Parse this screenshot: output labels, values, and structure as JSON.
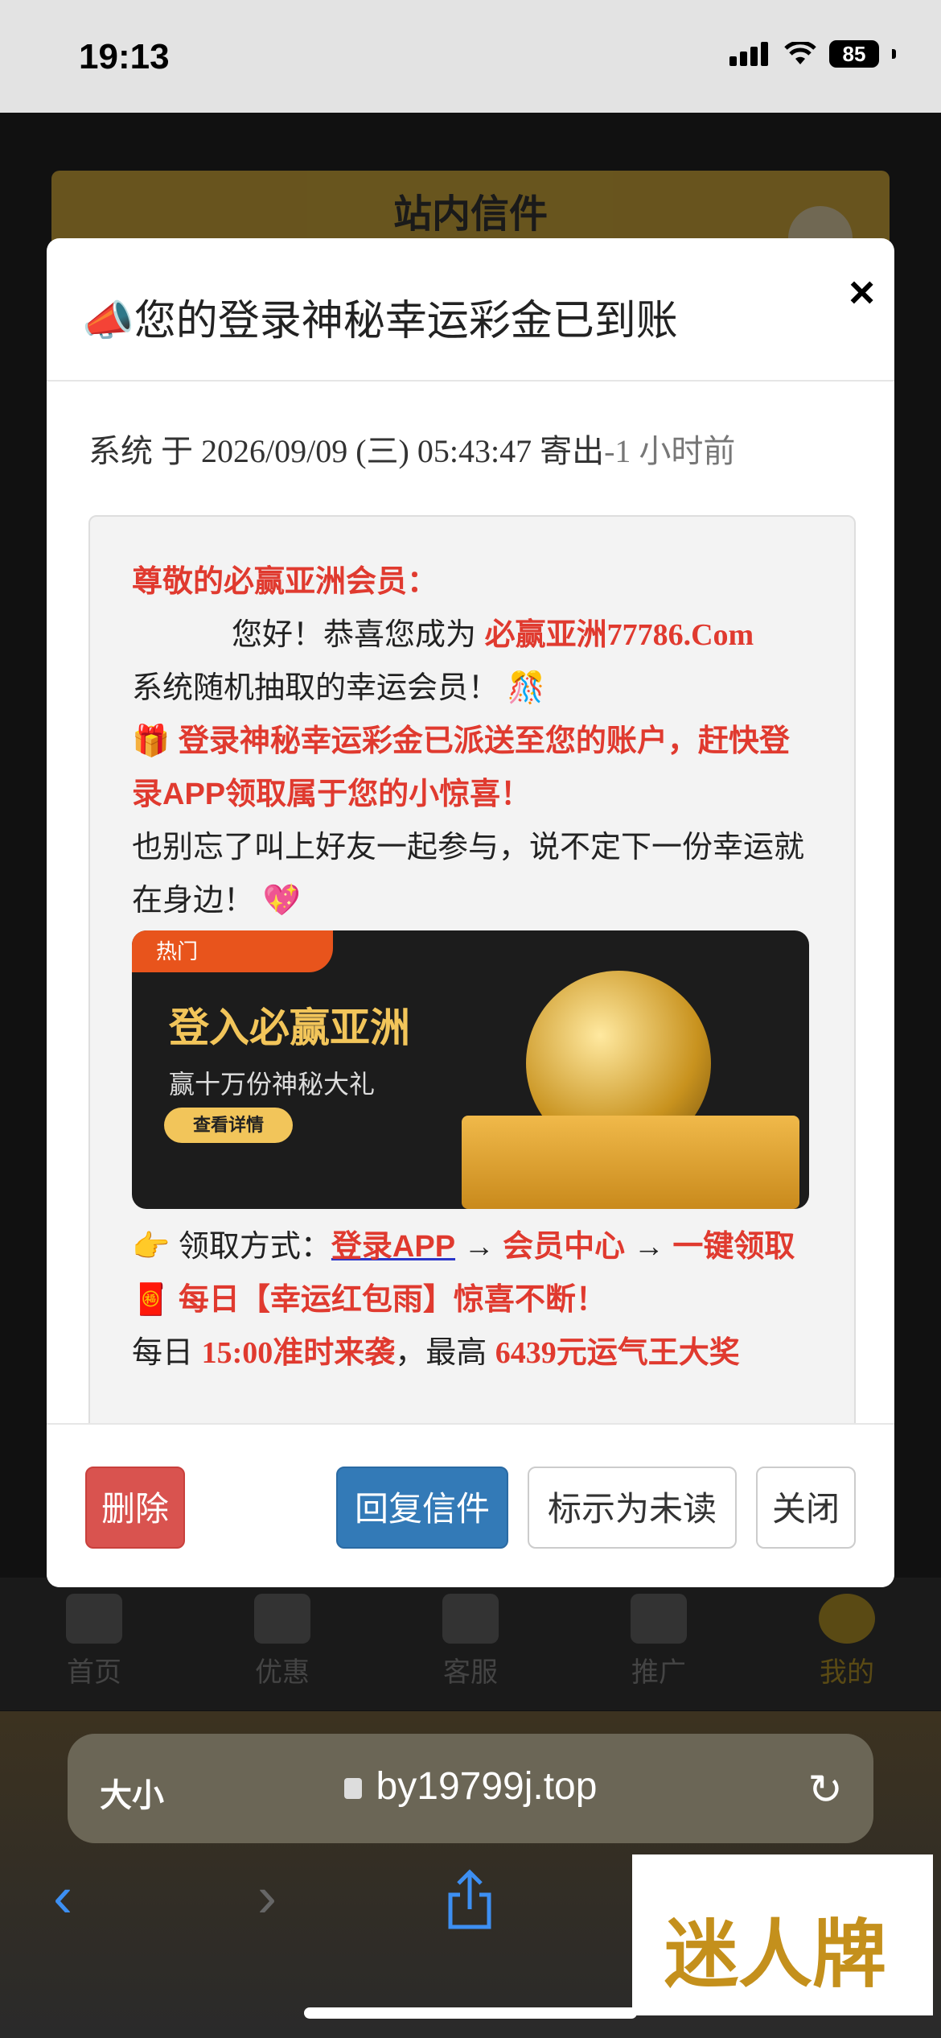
{
  "status": {
    "time": "19:13",
    "battery": "85"
  },
  "background": {
    "header": "站内信件"
  },
  "tabbar": [
    "首页",
    "优惠",
    "客服",
    "推广",
    "我的"
  ],
  "modal": {
    "icon": "📣",
    "title": "您的登录神秘幸运彩金已到账",
    "close_icon": "×",
    "sender": {
      "prefix": "系统 于 2026/09/09 (三) 05:43:47 寄出",
      "ago": "-1 小时前"
    },
    "message": {
      "greeting": "尊敬的必赢亚洲会员：",
      "line1_a": "您好！恭喜您成为 ",
      "line1_b": "必赢亚洲77786.Com",
      "line2": "系统随机抽取的幸运会员！",
      "line2_emoji": "🎊",
      "gift_emoji": "🎁",
      "line3": "登录神秘幸运彩金已派送至您的账户，赶快登录APP领取属于您的小惊喜！",
      "line4": "也别忘了叫上好友一起参与，说不定下一份幸运就在身边！",
      "line4_emoji": "💖",
      "banner": {
        "hot": "热门",
        "title": "登入必赢亚洲",
        "sub": "赢十万份神秘大礼",
        "btn": "查看详情"
      },
      "point_emoji": "👉",
      "method_label": "领取方式：",
      "method_link": "登录APP",
      "arrow": "→",
      "method_step2": "会员中心",
      "method_step3": "一键领取",
      "envelope_emoji": "🧧",
      "line5": "每日【幸运红包雨】惊喜不断！",
      "line6_a": "每日 ",
      "line6_b": "15:00准时来袭",
      "line6_c": "，最高 ",
      "line6_d": "6439元运气王大奖"
    },
    "buttons": {
      "delete": "删除",
      "reply": "回复信件",
      "mark_unread": "标示为未读",
      "close": "关闭"
    }
  },
  "browser": {
    "aa": "大小",
    "url": "by19799j.top",
    "back": "‹",
    "forward": "›"
  },
  "watermark": "迷人牌"
}
